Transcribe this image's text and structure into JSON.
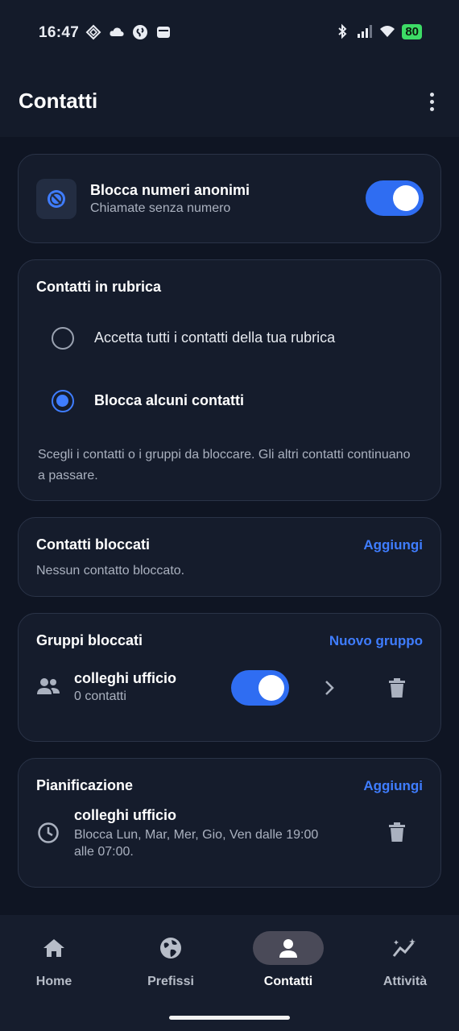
{
  "status_bar": {
    "time": "16:47",
    "battery": "80",
    "left_icons": [
      "vpn-icon",
      "cloud-icon",
      "shazam-icon",
      "wallet-icon"
    ],
    "right_icons": [
      "bluetooth-icon",
      "signal-icon",
      "wifi-icon",
      "battery-icon"
    ]
  },
  "app_bar": {
    "title": "Contatti",
    "menu_icon": "more-vertical-icon"
  },
  "anonymous_card": {
    "icon": "block-icon",
    "title": "Blocca numeri anonimi",
    "subtitle": "Chiamate senza numero",
    "toggle_on": true
  },
  "phonebook_card": {
    "title": "Contatti in rubrica",
    "options": [
      {
        "label": "Accetta tutti i contatti della tua rubrica",
        "selected": false
      },
      {
        "label": "Blocca alcuni contatti",
        "selected": true
      }
    ],
    "hint": "Scegli i contatti o i gruppi da bloccare. Gli altri contatti continuano a passare."
  },
  "blocked_contacts": {
    "title": "Contatti bloccati",
    "action": "Aggiungi",
    "empty_text": "Nessun contatto bloccato."
  },
  "blocked_groups": {
    "title": "Gruppi bloccati",
    "action": "Nuovo gruppo",
    "groups": [
      {
        "icon": "group-icon",
        "name": "colleghi ufficio",
        "count": "0 contatti",
        "toggle_on": true
      }
    ]
  },
  "schedule": {
    "title": "Pianificazione",
    "action": "Aggiungi",
    "items": [
      {
        "icon": "clock-icon",
        "name": "colleghi ufficio",
        "line1": "Blocca Lun, Mar, Mer, Gio, Ven dalle 19:00",
        "line2": "alle 07:00."
      }
    ]
  },
  "bottom_nav": {
    "items": [
      {
        "label": "Home",
        "icon": "home-icon",
        "active": false
      },
      {
        "label": "Prefissi",
        "icon": "globe-icon",
        "active": false
      },
      {
        "label": "Contatti",
        "icon": "person-icon",
        "active": true
      },
      {
        "label": "Attività",
        "icon": "activity-icon",
        "active": false
      }
    ]
  },
  "colors": {
    "background": "#0f1523",
    "card": "#151c2c",
    "accent": "#2f6df2",
    "link": "#3f7dff"
  }
}
